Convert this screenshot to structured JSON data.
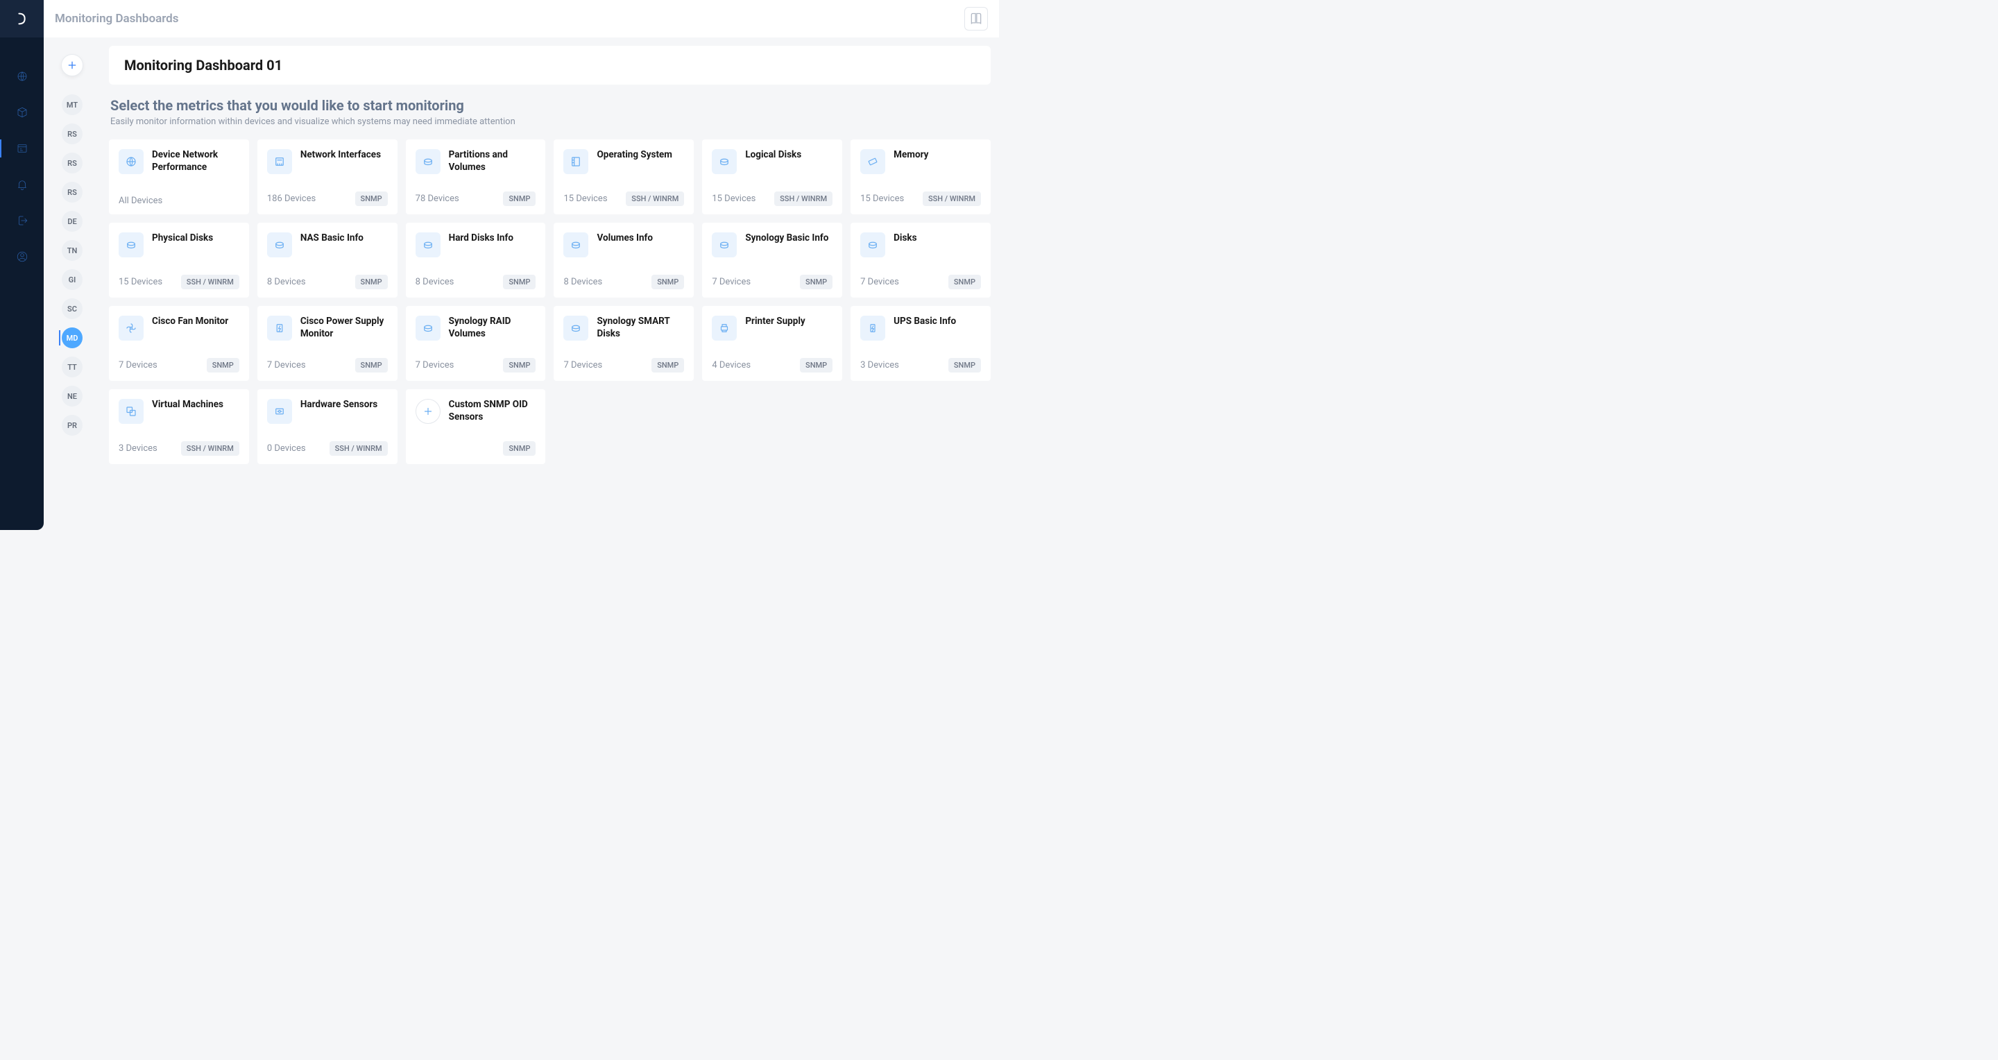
{
  "header": {
    "title": "Monitoring Dashboards"
  },
  "miniSidebar": {
    "items": [
      {
        "label": "MT",
        "active": false
      },
      {
        "label": "RS",
        "active": false
      },
      {
        "label": "RS",
        "active": false
      },
      {
        "label": "RS",
        "active": false
      },
      {
        "label": "DE",
        "active": false
      },
      {
        "label": "TN",
        "active": false
      },
      {
        "label": "GI",
        "active": false
      },
      {
        "label": "SC",
        "active": false
      },
      {
        "label": "MD",
        "active": true
      },
      {
        "label": "TT",
        "active": false
      },
      {
        "label": "NE",
        "active": false
      },
      {
        "label": "PR",
        "active": false
      }
    ]
  },
  "page": {
    "title": "Monitoring Dashboard 01",
    "heading": "Select the metrics that you would like to start monitoring",
    "sub": "Easily monitor information within devices and visualize which systems may need immediate attention"
  },
  "metrics": [
    {
      "title": "Device Network Performance",
      "count": "All Devices",
      "tag": "",
      "icon": "globe"
    },
    {
      "title": "Network Interfaces",
      "count": "186 Devices",
      "tag": "SNMP",
      "icon": "nic"
    },
    {
      "title": "Partitions and Volumes",
      "count": "78 Devices",
      "tag": "SNMP",
      "icon": "disk"
    },
    {
      "title": "Operating System",
      "count": "15 Devices",
      "tag": "SSH / WINRM",
      "icon": "os"
    },
    {
      "title": "Logical Disks",
      "count": "15 Devices",
      "tag": "SSH / WINRM",
      "icon": "disk"
    },
    {
      "title": "Memory",
      "count": "15 Devices",
      "tag": "SSH / WINRM",
      "icon": "memory"
    },
    {
      "title": "Physical Disks",
      "count": "15 Devices",
      "tag": "SSH / WINRM",
      "icon": "disk"
    },
    {
      "title": "NAS Basic Info",
      "count": "8 Devices",
      "tag": "SNMP",
      "icon": "disk"
    },
    {
      "title": "Hard Disks Info",
      "count": "8 Devices",
      "tag": "SNMP",
      "icon": "disk"
    },
    {
      "title": "Volumes Info",
      "count": "8 Devices",
      "tag": "SNMP",
      "icon": "disk"
    },
    {
      "title": "Synology Basic Info",
      "count": "7 Devices",
      "tag": "SNMP",
      "icon": "disk"
    },
    {
      "title": "Disks",
      "count": "7 Devices",
      "tag": "SNMP",
      "icon": "disk"
    },
    {
      "title": "Cisco Fan Monitor",
      "count": "7 Devices",
      "tag": "SNMP",
      "icon": "fan"
    },
    {
      "title": "Cisco Power Supply Monitor",
      "count": "7 Devices",
      "tag": "SNMP",
      "icon": "power"
    },
    {
      "title": "Synology RAID Volumes",
      "count": "7 Devices",
      "tag": "SNMP",
      "icon": "disk"
    },
    {
      "title": "Synology SMART Disks",
      "count": "7 Devices",
      "tag": "SNMP",
      "icon": "disk"
    },
    {
      "title": "Printer Supply",
      "count": "4 Devices",
      "tag": "SNMP",
      "icon": "printer"
    },
    {
      "title": "UPS Basic Info",
      "count": "3 Devices",
      "tag": "SNMP",
      "icon": "ups"
    },
    {
      "title": "Virtual Machines",
      "count": "3 Devices",
      "tag": "SSH / WINRM",
      "icon": "vm"
    },
    {
      "title": "Hardware Sensors",
      "count": "0 Devices",
      "tag": "SSH / WINRM",
      "icon": "sensor"
    },
    {
      "title": "Custom SNMP OID Sensors",
      "count": "",
      "tag": "SNMP",
      "icon": "plus"
    }
  ]
}
